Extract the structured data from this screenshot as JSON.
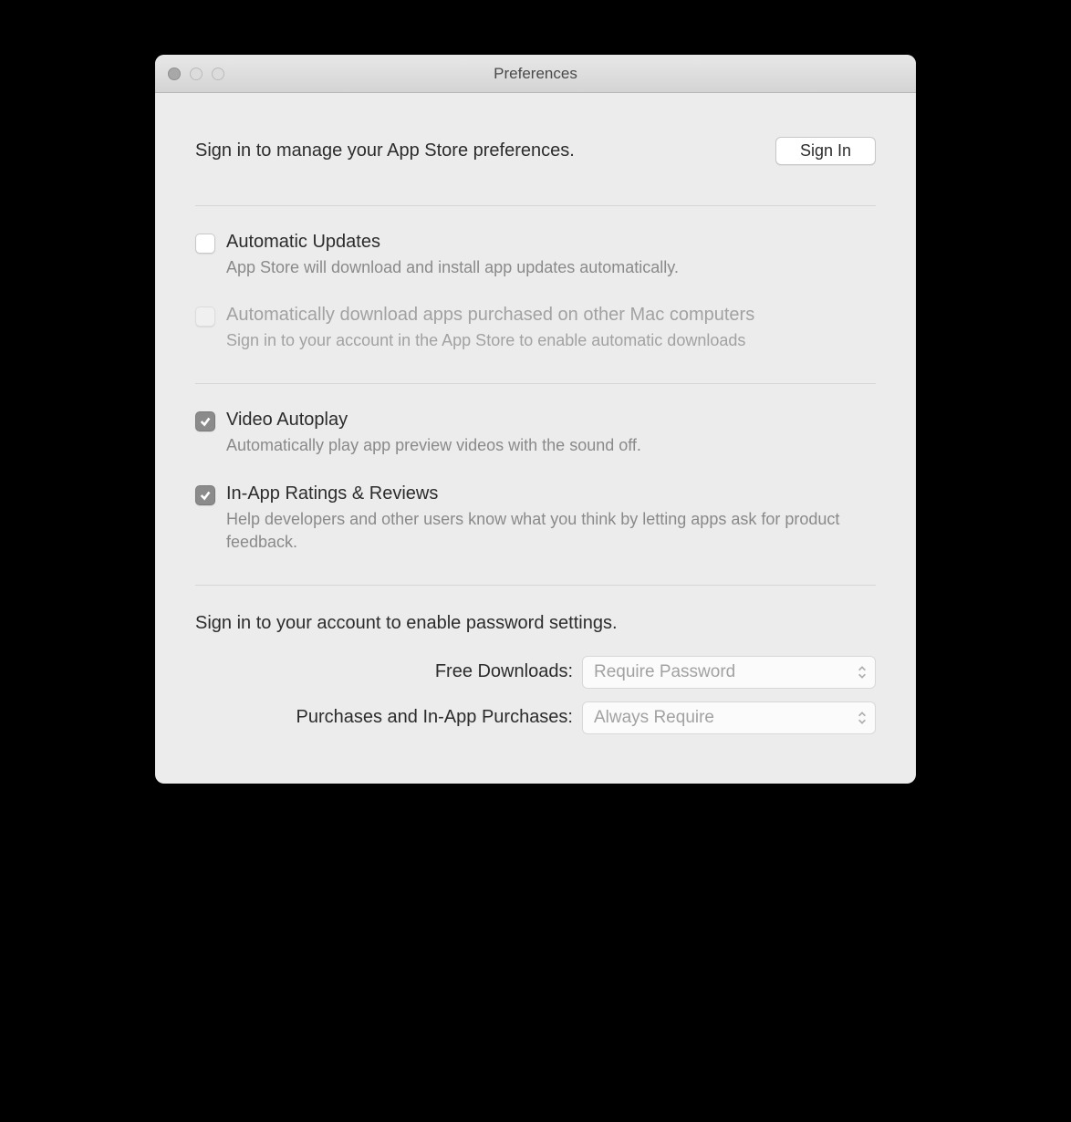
{
  "window": {
    "title": "Preferences"
  },
  "signin": {
    "prompt": "Sign in to manage your App Store preferences.",
    "button_label": "Sign In"
  },
  "prefs": {
    "auto_updates": {
      "label": "Automatic Updates",
      "desc": "App Store will download and install app updates automatically.",
      "checked": false,
      "disabled": false
    },
    "auto_download": {
      "label": "Automatically download apps purchased on other Mac computers",
      "desc": "Sign in to your account in the App Store to enable automatic downloads",
      "checked": false,
      "disabled": true
    },
    "video_autoplay": {
      "label": "Video Autoplay",
      "desc": "Automatically play app preview videos with the sound off.",
      "checked": true,
      "disabled": false
    },
    "ratings_reviews": {
      "label": "In-App Ratings & Reviews",
      "desc": "Help developers and other users know what you think by letting apps ask for product feedback.",
      "checked": true,
      "disabled": false
    }
  },
  "password": {
    "heading": "Sign in to your account to enable password settings.",
    "free": {
      "label": "Free Downloads:",
      "value": "Require Password"
    },
    "purchases": {
      "label": "Purchases and In-App Purchases:",
      "value": "Always Require"
    }
  }
}
